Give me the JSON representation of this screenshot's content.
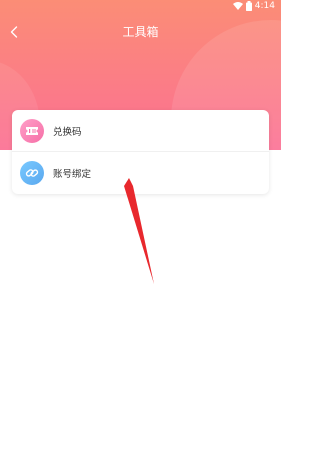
{
  "status_bar": {
    "time": "4:14"
  },
  "nav": {
    "title": "工具箱",
    "back_icon": "chevron-left-icon"
  },
  "menu": {
    "items": [
      {
        "label": "兑换码",
        "icon": "ticket-icon",
        "icon_color": "#f66fa7"
      },
      {
        "label": "账号绑定",
        "icon": "link-icon",
        "icon_color": "#5aa8ef"
      }
    ]
  },
  "colors": {
    "header_top": "#fb8d76",
    "header_bottom": "#fb6f93",
    "annotation_arrow": "#e8282d"
  }
}
